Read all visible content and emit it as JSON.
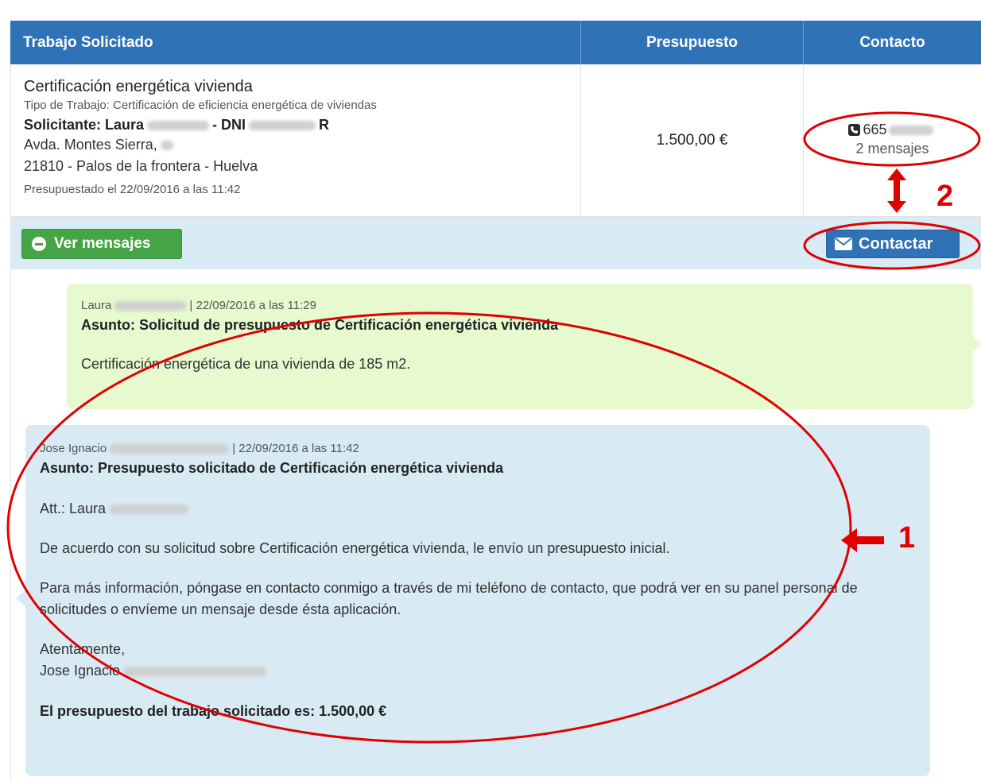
{
  "table": {
    "headers": {
      "job": "Trabajo Solicitado",
      "budget": "Presupuesto",
      "contact": "Contacto"
    },
    "row": {
      "title": "Certificación energética vivienda",
      "job_type": "Tipo de Trabajo: Certificación de eficiencia energética de viviendas",
      "applicant_prefix": "Solicitante: Laura",
      "dni_label": "- DNI",
      "dni_suffix": "R",
      "address_line1": "Avda. Montes Sierra,",
      "address_line2": "21810 - Palos de la frontera - Huelva",
      "budgeted_on": "Presupuestado el 22/09/2016 a las 11:42",
      "budget": "1.500,00 €",
      "phone": "665",
      "messages_link": "2 mensajes"
    }
  },
  "actions": {
    "view_messages": "Ver mensajes",
    "contact": "Contactar"
  },
  "messages": [
    {
      "author": "Laura",
      "timestamp": "| 22/09/2016 a las 11:29",
      "subject": "Asunto: Solicitud de presupuesto de Certificación energética vivienda",
      "body": "Certificación energética de una vivienda de 185 m2."
    },
    {
      "author": "Jose Ignacio",
      "timestamp": "| 22/09/2016 a las 11:42",
      "subject": "Asunto: Presupuesto solicitado de Certificación energética vivienda",
      "att": "Att.: Laura",
      "p1": "De acuerdo con su solicitud sobre Certificación energética vivienda, le envío un presupuesto inicial.",
      "p2": "Para más información, póngase en contacto conmigo a través de mi teléfono de contacto, que podrá ver en su panel personal de solicitudes o envíeme un mensaje desde ésta aplicación.",
      "closing": "Atentamente,",
      "signature": "Jose Ignacio",
      "total": "El presupuesto del trabajo solicitado es: 1.500,00 €"
    }
  ],
  "annotations": {
    "label_1": "1",
    "label_2": "2",
    "color": "#e00000"
  },
  "colors": {
    "header_blue": "#2f72b6",
    "green_button": "#45a545",
    "green_bubble": "#e6f9cf",
    "blue_bubble": "#d8eaf4"
  }
}
